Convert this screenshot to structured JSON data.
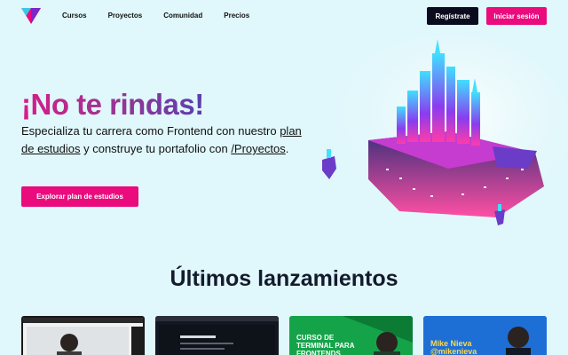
{
  "nav": {
    "links": [
      "Cursos",
      "Proyectos",
      "Comunidad",
      "Precios"
    ],
    "register_label": "Regístrate",
    "login_label": "Iniciar sesión"
  },
  "hero": {
    "title": "¡No te rindas!",
    "text_part1": "Especializa tu carrera como Frontend con nuestro ",
    "link1": "plan de estudios",
    "text_part2": " y construye tu portafolio con ",
    "link2": "/Proyectos",
    "text_part3": ".",
    "button_label": "Explorar plan de estudios"
  },
  "releases": {
    "title": "Últimos lanzamientos",
    "cards": [
      {
        "title": ""
      },
      {
        "title": ""
      },
      {
        "title": "CURSO DE TERMINAL PARA FRONTENDS"
      },
      {
        "title": "Mike Nieva @mikenieva"
      }
    ]
  },
  "colors": {
    "background": "#e0f7fb",
    "accent": "#ea0b7d",
    "dark": "#0b0b1f"
  }
}
